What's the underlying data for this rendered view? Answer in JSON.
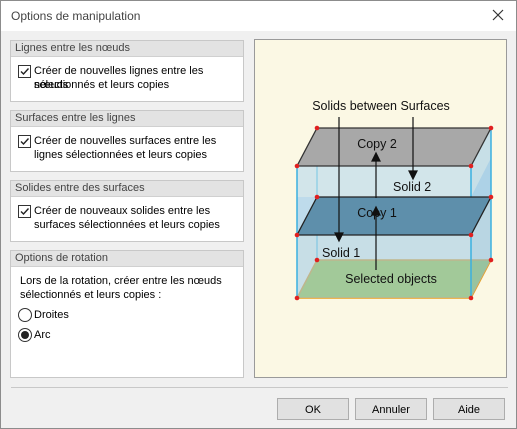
{
  "dialog": {
    "title": "Options de manipulation"
  },
  "groups": {
    "nodes": {
      "header": "Lignes entre les nœuds",
      "checkbox_label_line1": "Créer de nouvelles lignes entre les nœuds",
      "checkbox_label_line2": "sélectionnés et leurs copies",
      "checked": true
    },
    "lines": {
      "header": "Surfaces entre les lignes",
      "checkbox_label_line1": "Créer de nouvelles surfaces entre les",
      "checkbox_label_line2": "lignes sélectionnées et leurs copies",
      "checked": true
    },
    "surfaces": {
      "header": "Solides entre des surfaces",
      "checkbox_label_line1": "Créer de nouveaux solides entre les",
      "checkbox_label_line2": "surfaces sélectionnées et leurs copies",
      "checked": true
    },
    "rotation": {
      "header": "Options de rotation",
      "text_line1": "Lors de la rotation, créer entre les nœuds",
      "text_line2": "sélectionnés et leurs copies :",
      "options": [
        {
          "label": "Droites",
          "selected": false
        },
        {
          "label": "Arc",
          "selected": true
        }
      ]
    }
  },
  "illustration": {
    "title": "Solids between Surfaces",
    "copy2": "Copy 2",
    "solid2": "Solid 2",
    "copy1": "Copy 1",
    "solid1": "Solid 1",
    "selected": "Selected objects"
  },
  "buttons": {
    "ok": "OK",
    "cancel": "Annuler",
    "help": "Aide"
  }
}
